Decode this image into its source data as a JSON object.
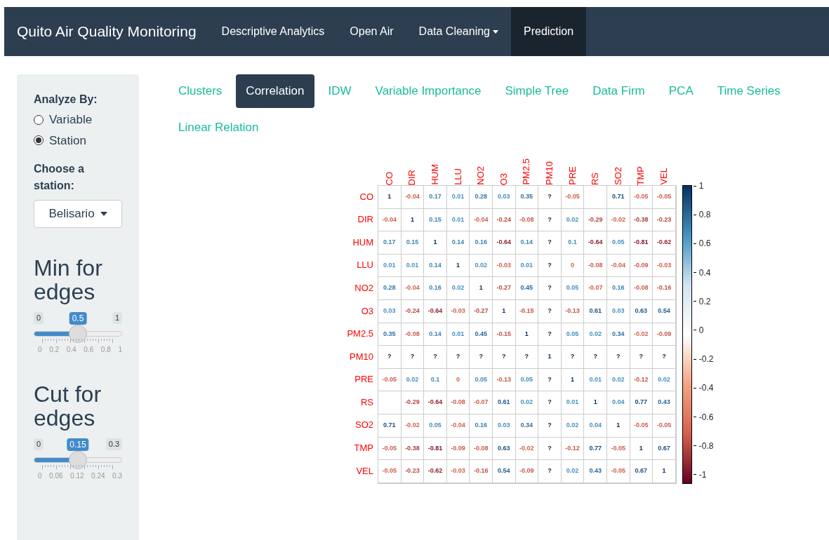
{
  "navbar": {
    "brand": "Quito Air Quality Monitoring",
    "items": [
      {
        "label": "Descriptive Analytics",
        "selected": false,
        "dropdown": false
      },
      {
        "label": "Open Air",
        "selected": false,
        "dropdown": false
      },
      {
        "label": "Data Cleaning",
        "selected": false,
        "dropdown": true
      },
      {
        "label": "Prediction",
        "selected": true,
        "dropdown": false
      }
    ]
  },
  "sidebar": {
    "analyze_label": "Analyze By:",
    "radios": [
      {
        "label": "Variable",
        "selected": false
      },
      {
        "label": "Station",
        "selected": true
      }
    ],
    "station_label": "Choose a station:",
    "station_value": "Belisario",
    "sliders": [
      {
        "title": "Min for edges",
        "min": "0",
        "max": "1",
        "value": "0.5",
        "level": 0.5,
        "ticks": [
          "0",
          "0.2",
          "0.4",
          "0.6",
          "0.8",
          "1"
        ]
      },
      {
        "title": "Cut for edges",
        "min": "0",
        "max": "0.3",
        "value": "0.15",
        "level": 0.5,
        "ticks": [
          "0",
          "0.06",
          "0.12",
          "0.24",
          "0.3"
        ]
      }
    ]
  },
  "tabs": [
    {
      "label": "Clusters",
      "selected": false
    },
    {
      "label": "Correlation",
      "selected": true
    },
    {
      "label": "IDW",
      "selected": false
    },
    {
      "label": "Variable Importance",
      "selected": false
    },
    {
      "label": "Simple Tree",
      "selected": false
    },
    {
      "label": "Data Firm",
      "selected": false
    },
    {
      "label": "PCA",
      "selected": false
    },
    {
      "label": "Time Series",
      "selected": false
    },
    {
      "label": "Linear Relation",
      "selected": false
    }
  ],
  "matrix": {
    "column_labels": [
      "CO",
      "DIR",
      "HUM",
      "LLU",
      "NO2",
      "O3",
      "PM2.5",
      "PM10",
      "PRE",
      "RS",
      "SO2",
      "TMP",
      "VEL"
    ],
    "row_labels": [
      "CO",
      "DIR",
      "HUM",
      "LLU",
      "NO2",
      "O3",
      "PM2.5",
      "PM10",
      "PRE",
      "RS",
      "SO2",
      "TMP",
      "VEL"
    ],
    "rows": [
      [
        "1",
        "-0.04",
        "0.17",
        "0.01",
        "0.28",
        "0.03",
        "0.35",
        "?",
        "-0.05",
        null,
        "0.71",
        "-0.05",
        "-0.05"
      ],
      [
        "-0.04",
        "1",
        "0.15",
        "0.01",
        "-0.04",
        "-0.24",
        "-0.08",
        "?",
        "0.02",
        "-0.29",
        "-0.02",
        "-0.38",
        "-0.23"
      ],
      [
        "0.17",
        "0.15",
        "1",
        "0.14",
        "0.16",
        "-0.64",
        "0.14",
        "?",
        "0.1",
        "-0.64",
        "0.05",
        "-0.81",
        "-0.62"
      ],
      [
        "0.01",
        "0.01",
        "0.14",
        "1",
        "0.02",
        "-0.03",
        "0.01",
        "?",
        "0",
        "-0.08",
        "-0.04",
        "-0.09",
        "-0.03"
      ],
      [
        "0.28",
        "-0.04",
        "0.16",
        "0.02",
        "1",
        "-0.27",
        "0.45",
        "?",
        "0.05",
        "-0.07",
        "0.16",
        "-0.08",
        "-0.16"
      ],
      [
        "0.03",
        "-0.24",
        "-0.64",
        "-0.03",
        "-0.27",
        "1",
        "-0.15",
        "?",
        "-0.13",
        "0.61",
        "0.03",
        "0.63",
        "0.54"
      ],
      [
        "0.35",
        "-0.08",
        "0.14",
        "0.01",
        "0.45",
        "-0.15",
        "1",
        "?",
        "0.05",
        "0.02",
        "0.34",
        "-0.02",
        "-0.09"
      ],
      [
        "?",
        "?",
        "?",
        "?",
        "?",
        "?",
        "?",
        "1",
        "?",
        "?",
        "?",
        "?",
        "?"
      ],
      [
        "-0.05",
        "0.02",
        "0.1",
        "0",
        "0.05",
        "-0.13",
        "0.05",
        "?",
        "1",
        "0.01",
        "0.02",
        "-0.12",
        "0.02"
      ],
      [
        null,
        "-0.29",
        "-0.64",
        "-0.08",
        "-0.07",
        "0.61",
        "0.02",
        "?",
        "0.01",
        "1",
        "0.04",
        "0.77",
        "0.43"
      ],
      [
        "0.71",
        "-0.02",
        "0.05",
        "-0.04",
        "0.16",
        "0.03",
        "0.34",
        "?",
        "0.02",
        "0.04",
        "1",
        "-0.05",
        "-0.05"
      ],
      [
        "-0.05",
        "-0.38",
        "-0.81",
        "-0.09",
        "-0.08",
        "0.63",
        "-0.02",
        "?",
        "-0.12",
        "0.77",
        "-0.05",
        "1",
        "0.67"
      ],
      [
        "-0.05",
        "-0.23",
        "-0.62",
        "-0.03",
        "-0.16",
        "0.54",
        "-0.09",
        "?",
        "0.02",
        "0.43",
        "-0.05",
        "0.67",
        "1"
      ]
    ],
    "legend_ticks": [
      "1",
      "0.8",
      "0.6",
      "0.4",
      "0.2",
      "0",
      "-0.2",
      "-0.4",
      "-0.6",
      "-0.8",
      "-1"
    ]
  }
}
